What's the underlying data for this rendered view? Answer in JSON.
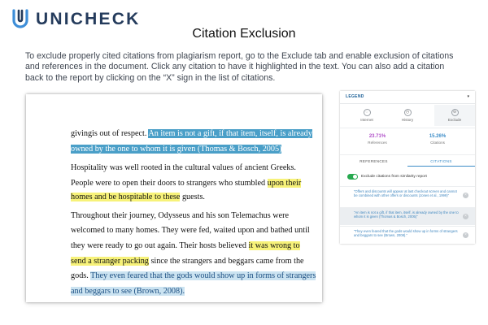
{
  "brand": {
    "name": "UNICHECK"
  },
  "page": {
    "title": "Citation Exclusion",
    "intro": "To exclude properly cited citations from plagiarism report, go to the Exclude tab and enable exclusion of citations and references in the document. Click any citation to have it highlighted in the text. You can also add a citation back to the report by clicking on the “X” sign in the list of citations."
  },
  "document": {
    "lines": [
      {
        "segments": [
          {
            "text": "givingis out of respect. ",
            "style": "plain"
          },
          {
            "text": "An item is not a gift, if that item, itself, is already",
            "style": "blue"
          }
        ]
      },
      {
        "segments": [
          {
            "text": "owned by the one to whom it is given (Thomas & Bosch, 2005)",
            "style": "blue"
          }
        ]
      },
      {
        "segments": [
          {
            "text": "Hospitality was well rooted in the cultural values of ancient Greeks.",
            "style": "plain"
          }
        ]
      },
      {
        "segments": [
          {
            "text": "People were to open  their doors to strangers who stumbled ",
            "style": "plain"
          },
          {
            "text": "upon their",
            "style": "yellow"
          }
        ]
      },
      {
        "segments": [
          {
            "text": "homes and be hospitable to these",
            "style": "yellow"
          },
          {
            "text": " guests.",
            "style": "plain"
          }
        ]
      },
      {
        "segments": [
          {
            "text": "Throughout their journey, Odysseus and his son Telemachus were",
            "style": "plain"
          }
        ]
      },
      {
        "segments": [
          {
            "text": "welcomed to many homes.  They were fed, waited upon and bathed until",
            "style": "plain"
          }
        ]
      },
      {
        "segments": [
          {
            "text": "they were ready to go out again. Their hosts  believed ",
            "style": "plain"
          },
          {
            "text": "it was wrong to",
            "style": "yellow"
          }
        ]
      },
      {
        "segments": [
          {
            "text": "send a stranger packing",
            "style": "yellow"
          },
          {
            "text": " since the strangers and beggars came from the",
            "style": "plain"
          }
        ]
      },
      {
        "segments": [
          {
            "text": "gods. ",
            "style": "plain"
          },
          {
            "text": "They even feared that the gods would show up in forms of strangers",
            "style": "lightblue"
          }
        ]
      },
      {
        "segments": [
          {
            "text": "and beggars to see (Brown, 2008).",
            "style": "lightblue"
          }
        ]
      }
    ]
  },
  "sidebar": {
    "legend_label": "LEGEND",
    "legend_caret": "▾",
    "tabs": [
      {
        "label": "Internet",
        "icon": "globe-icon",
        "glyph": "◌"
      },
      {
        "label": "History",
        "icon": "clock-icon",
        "glyph": "◷"
      },
      {
        "label": "Exclude",
        "icon": "exclude-icon",
        "glyph": "⊖"
      }
    ],
    "stats": [
      {
        "value": "23.71%",
        "label": "References",
        "color": "#b04fc9"
      },
      {
        "value": "15.26%",
        "label": "Citations",
        "color": "#3d8dc8"
      }
    ],
    "subtabs": [
      {
        "label": "REFERENCES",
        "active": false
      },
      {
        "label": "CITATIONS",
        "active": true
      }
    ],
    "toggle_label": "Exclude citations from similarity report",
    "toggle_on": true,
    "citations": [
      {
        "text": "“Offers and discounts will appear at last checkout screen and cannot be combined with other offers or discounts (Jones et al., 1999)”",
        "selected": false,
        "remove": "×"
      },
      {
        "text": "“An item is not a gift, if that item, itself, is already owned by the one to whom it is given (Thomas & Bosch, 2005)”",
        "selected": true,
        "remove": "×"
      },
      {
        "text": "“They even feared that the gods would show up in forms of strangers and beggars to see (Brown, 2008).”",
        "selected": false,
        "remove": "×"
      }
    ]
  }
}
